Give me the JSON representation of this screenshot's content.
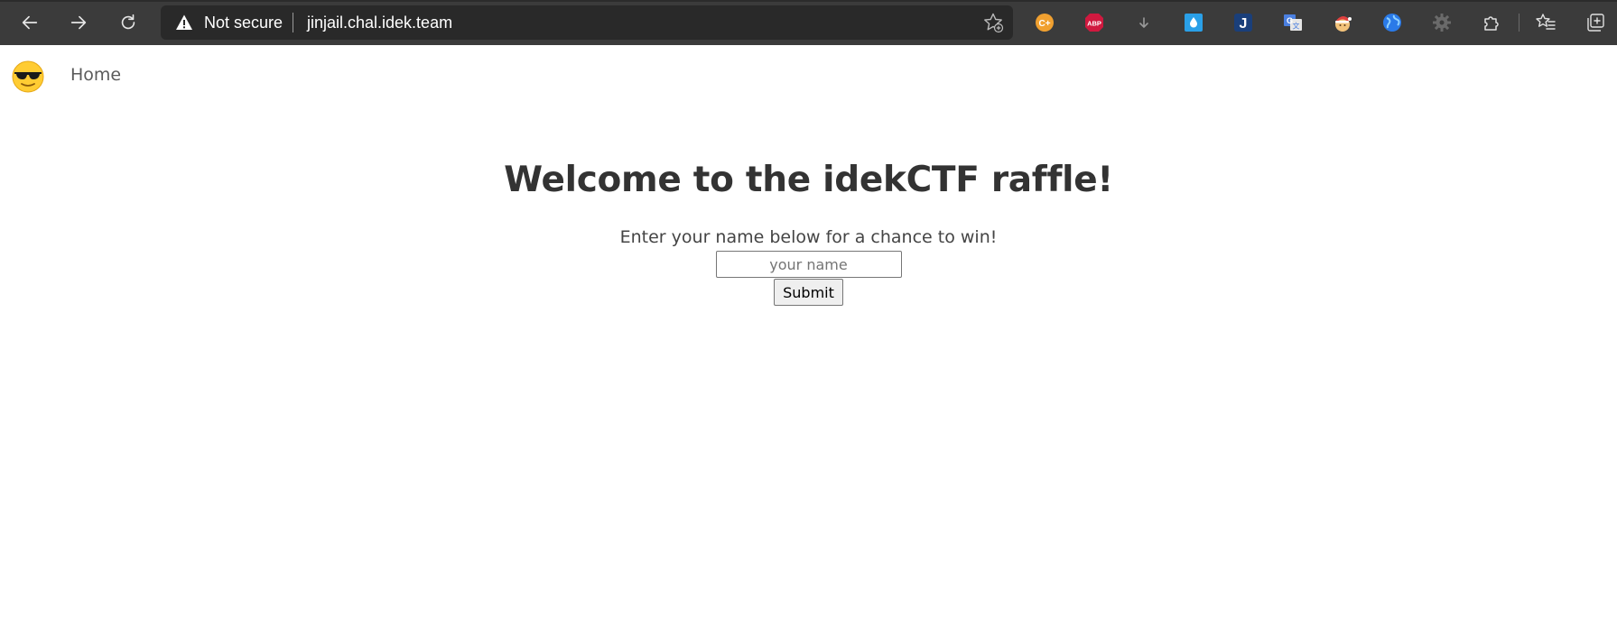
{
  "browser": {
    "security_label": "Not secure",
    "url": "jinjail.chal.idek.team",
    "back_icon": "back-arrow-icon",
    "forward_icon": "forward-arrow-icon",
    "reload_icon": "reload-icon",
    "extensions": [
      {
        "name": "coupon-extension-icon",
        "text": "C+",
        "color": "#f0a030"
      },
      {
        "name": "adblock-plus-icon",
        "text": "ABP",
        "color": "#d0193f"
      },
      {
        "name": "download-arrow-icon",
        "text": "",
        "color": "#9a9a9a"
      },
      {
        "name": "water-drop-extension-icon",
        "text": "",
        "color": "#2aa0e8"
      },
      {
        "name": "j-extension-icon",
        "text": "J",
        "color": "#1a5aa8"
      },
      {
        "name": "google-translate-icon",
        "text": "G",
        "color": "#4a7fe0"
      },
      {
        "name": "santa-extension-icon",
        "text": "",
        "color": "#e04040"
      },
      {
        "name": "globe-extension-icon",
        "text": "",
        "color": "#2a7ae8"
      },
      {
        "name": "gear-extension-icon",
        "text": "",
        "color": "#6a6a6a"
      },
      {
        "name": "puzzle-extensions-icon",
        "text": "",
        "color": "#e0e0e0"
      },
      {
        "name": "favorites-icon",
        "text": "",
        "color": "#e0e0e0"
      },
      {
        "name": "collections-icon",
        "text": "",
        "color": "#e0e0e0"
      }
    ]
  },
  "site": {
    "logo": "sunglasses-emoji",
    "nav_home": "Home"
  },
  "main": {
    "title": "Welcome to the idekCTF raffle!",
    "subtitle": "Enter your name below for a chance to win!",
    "name_placeholder": "your name",
    "name_value": "",
    "submit_label": "Submit"
  }
}
